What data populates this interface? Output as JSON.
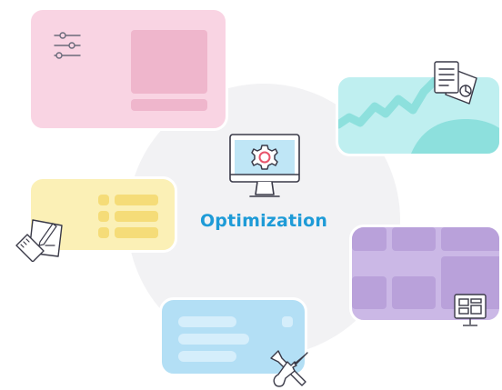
{
  "title": "Optimization",
  "colors": {
    "accent": "#1e9bd7",
    "pink_card": "#f9d4e3",
    "teal_card": "#bfeff0",
    "yellow_card": "#fbf0b6",
    "purple_card": "#cbb8e6",
    "blue_card": "#b3dff5",
    "gear": "#e8546b"
  },
  "icons": {
    "center": "monitor-gear-icon",
    "settings": "sliders-icon",
    "reports": "documents-chart-icon",
    "design": "ruler-pencil-icon",
    "layout": "monitor-layout-icon",
    "tools": "wrench-screwdriver-icon"
  }
}
